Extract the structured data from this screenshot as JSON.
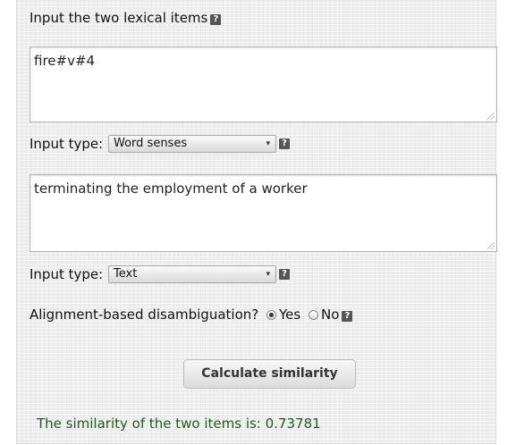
{
  "form": {
    "heading": "Input the two lexical items",
    "help_glyph": "?",
    "item1": {
      "value": "fire#v#4",
      "input_type_label": "Input type:",
      "input_type_selected": "Word senses"
    },
    "item2": {
      "value": "terminating the employment of a worker",
      "input_type_label": "Input type:",
      "input_type_selected": "Text"
    },
    "alignment": {
      "label": "Alignment-based disambiguation?",
      "options": [
        "Yes",
        "No"
      ],
      "selected": "Yes"
    },
    "submit_label": "Calculate similarity",
    "result_text": "The similarity of the two items is: 0.73781"
  },
  "colors": {
    "result_text": "#1e5a1e",
    "panel_background": "#eeeeee",
    "help_icon": "#555555"
  },
  "icons": [
    "help-icon",
    "dropdown-arrow-icon",
    "resize-grip-icon"
  ]
}
